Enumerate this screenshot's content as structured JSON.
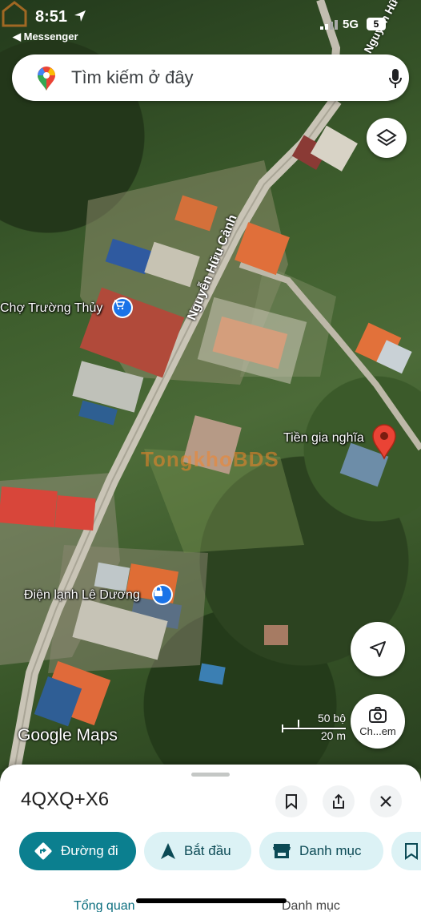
{
  "status_bar": {
    "time": "8:51",
    "back_app": "◀ Messenger",
    "network": "5G",
    "battery": "5"
  },
  "search": {
    "placeholder": "Tìm kiếm ở đây",
    "icons": [
      "maps-pin-icon",
      "microphone-icon"
    ]
  },
  "map": {
    "roads": [
      "Nguyễn Hữu Cảnh",
      "Nguyễn Hữu"
    ],
    "places": [
      {
        "name": "Chợ Trường Thủy",
        "icon": "shopping-cart-icon"
      },
      {
        "name": "Điện lạnh Lê Dương",
        "icon": "lock-icon"
      },
      {
        "name": "Tiền gia nghĩa",
        "icon": "red-pin-icon"
      }
    ],
    "watermark": "TongkhoBDS",
    "attribution": "Google Maps",
    "scale": {
      "imperial": "50 bộ",
      "metric": "20 m"
    },
    "camera_label": "Ch...em",
    "colors": {
      "pin": "#ea4335",
      "poi_blue": "#1a73e8"
    }
  },
  "sheet": {
    "title": "4QXQ+X6",
    "chips": [
      {
        "label": "Đường đi",
        "icon": "directions-icon"
      },
      {
        "label": "Bắt đầu",
        "icon": "navigation-arrow-icon"
      },
      {
        "label": "Danh mục",
        "icon": "store-icon"
      }
    ],
    "tabs": [
      "Tổng quan",
      "Danh mục"
    ],
    "accent": "#0b7f8f"
  }
}
